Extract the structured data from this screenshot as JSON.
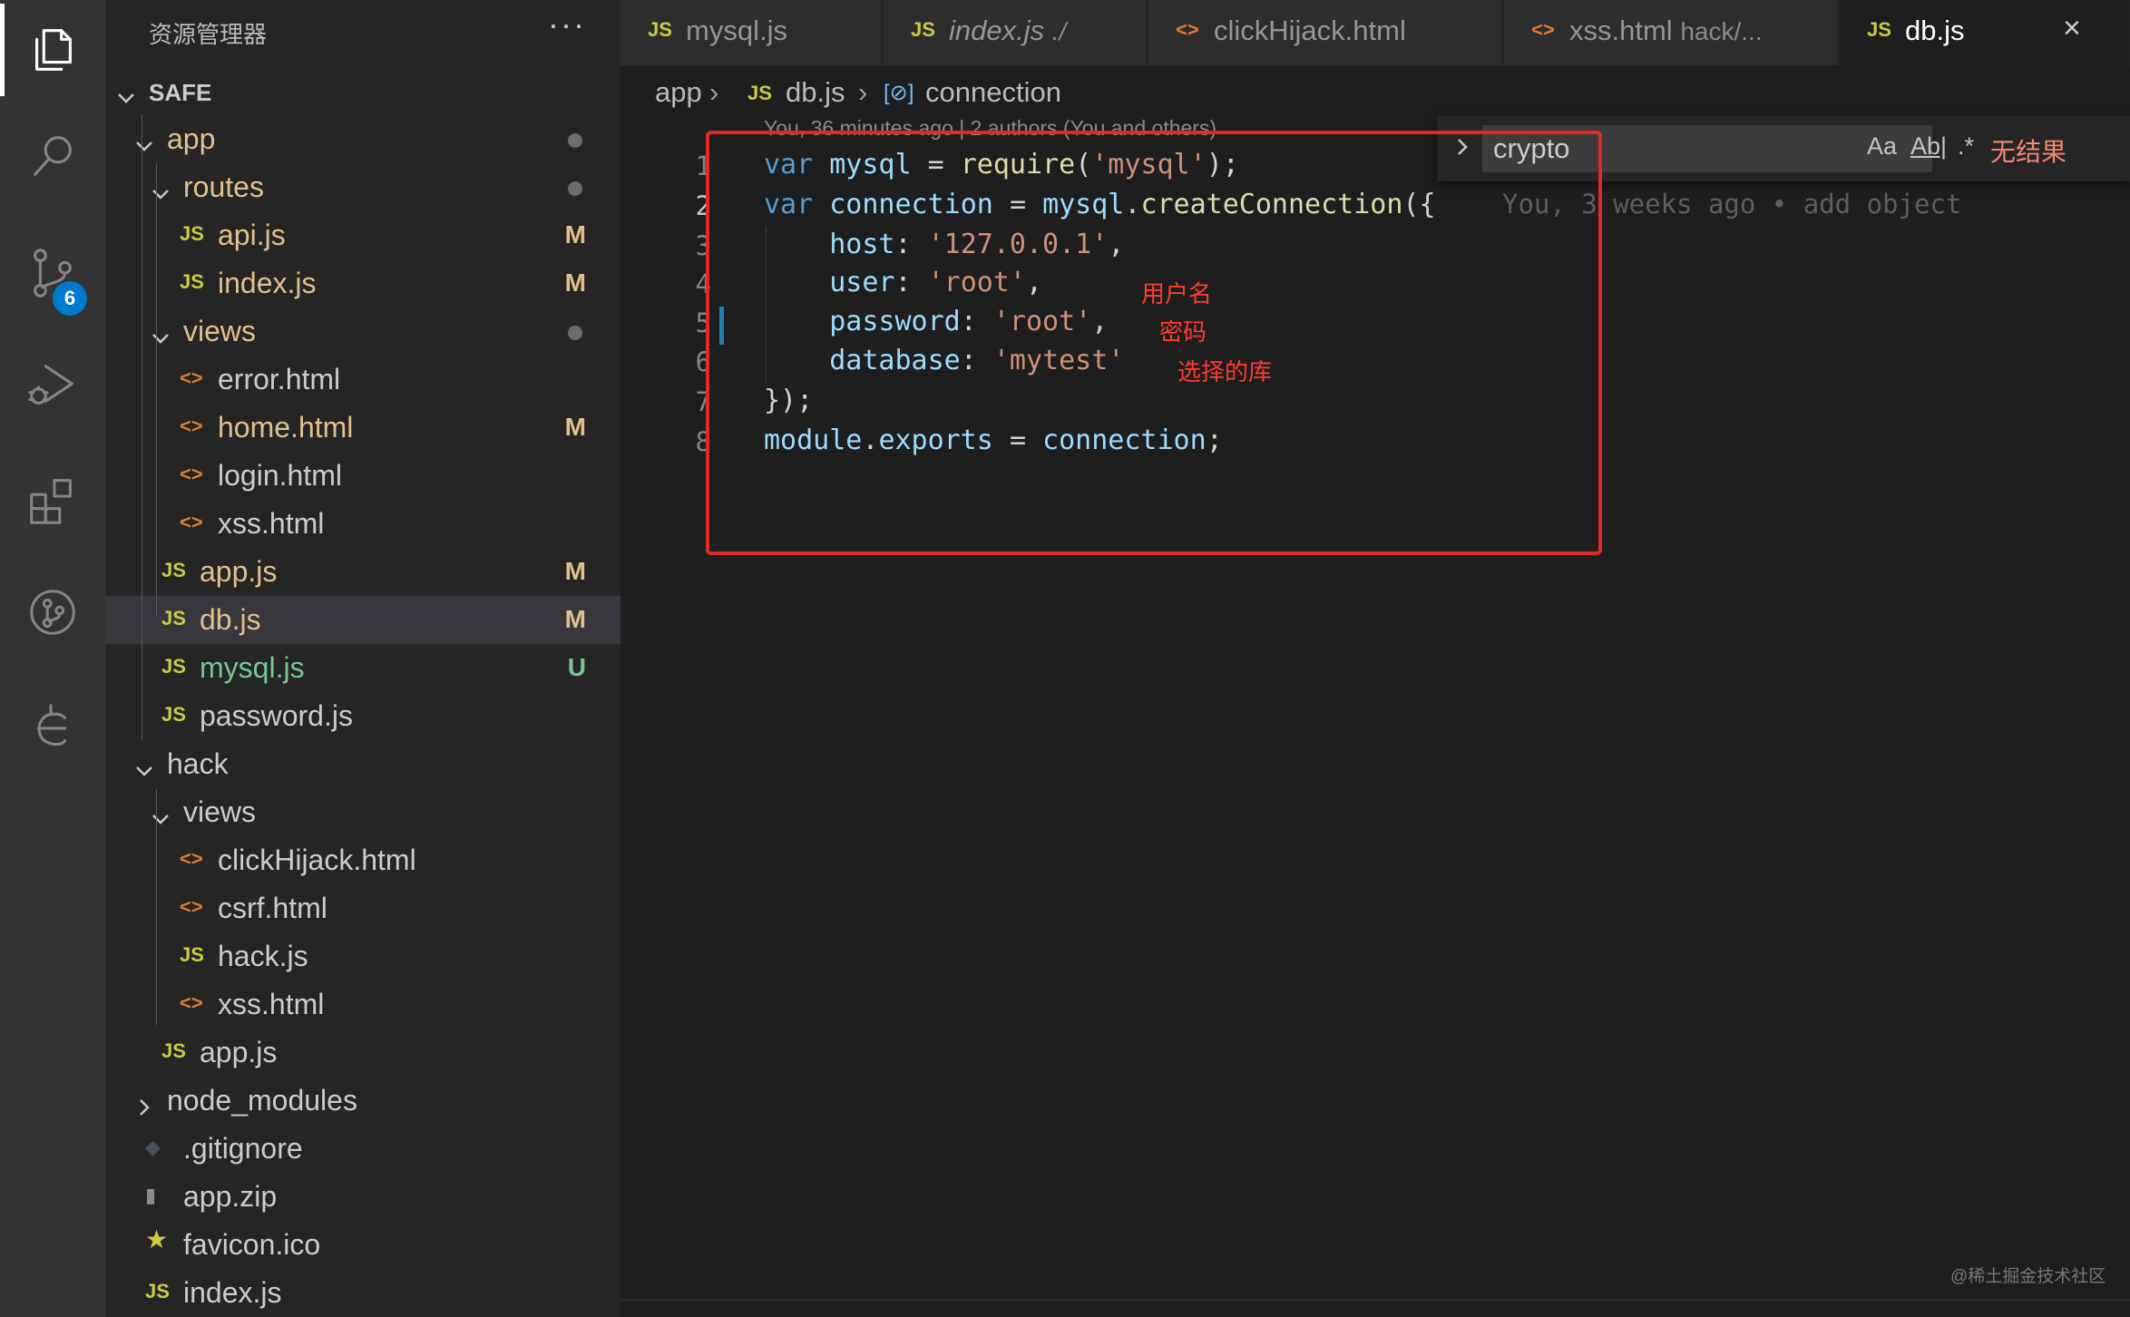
{
  "activity_bar": {
    "items": [
      {
        "name": "explorer",
        "icon": "files-icon",
        "active": true
      },
      {
        "name": "search",
        "icon": "search-icon",
        "active": false
      },
      {
        "name": "source-control",
        "icon": "source-control-icon",
        "active": false,
        "badge": "6"
      },
      {
        "name": "run-debug",
        "icon": "run-debug-icon",
        "active": false
      },
      {
        "name": "extensions",
        "icon": "extensions-icon",
        "active": false
      },
      {
        "name": "git-graph",
        "icon": "git-graph-icon",
        "active": false
      },
      {
        "name": "gitlens",
        "icon": "gitlens-icon",
        "active": false
      }
    ]
  },
  "sidebar": {
    "title": "资源管理器",
    "more": "···",
    "root": "SAFE",
    "items": [
      {
        "label": "app",
        "type": "folder",
        "open": true,
        "decoration": "dot",
        "color": "mod"
      },
      {
        "label": "routes",
        "type": "folder",
        "open": true,
        "decoration": "dot",
        "color": "mod"
      },
      {
        "label": "api.js",
        "type": "js",
        "decoration": "M",
        "color": "mod"
      },
      {
        "label": "index.js",
        "type": "js",
        "decoration": "M",
        "color": "mod"
      },
      {
        "label": "views",
        "type": "folder",
        "open": true,
        "decoration": "dot",
        "color": "mod"
      },
      {
        "label": "error.html",
        "type": "html",
        "decoration": "",
        "color": "plain"
      },
      {
        "label": "home.html",
        "type": "html",
        "decoration": "M",
        "color": "mod"
      },
      {
        "label": "login.html",
        "type": "html",
        "decoration": "",
        "color": "plain"
      },
      {
        "label": "xss.html",
        "type": "html",
        "decoration": "",
        "color": "plain"
      },
      {
        "label": "app.js",
        "type": "js",
        "decoration": "M",
        "color": "mod"
      },
      {
        "label": "db.js",
        "type": "js",
        "decoration": "M",
        "color": "mod",
        "selected": true
      },
      {
        "label": "mysql.js",
        "type": "js",
        "decoration": "U",
        "color": "unt"
      },
      {
        "label": "password.js",
        "type": "js",
        "decoration": "",
        "color": "plain"
      },
      {
        "label": "hack",
        "type": "folder",
        "open": true,
        "decoration": "",
        "color": "plain"
      },
      {
        "label": "views",
        "type": "folder",
        "open": true,
        "decoration": "",
        "color": "plain"
      },
      {
        "label": "clickHijack.html",
        "type": "html",
        "decoration": "",
        "color": "plain"
      },
      {
        "label": "csrf.html",
        "type": "html",
        "decoration": "",
        "color": "plain"
      },
      {
        "label": "hack.js",
        "type": "js",
        "decoration": "",
        "color": "plain"
      },
      {
        "label": "xss.html",
        "type": "html",
        "decoration": "",
        "color": "plain"
      },
      {
        "label": "app.js",
        "type": "js",
        "decoration": "",
        "color": "plain"
      },
      {
        "label": "node_modules",
        "type": "folder",
        "open": false,
        "decoration": "",
        "color": "plain"
      },
      {
        "label": ".gitignore",
        "type": "git",
        "decoration": "",
        "color": "plain"
      },
      {
        "label": "app.zip",
        "type": "zip",
        "decoration": "",
        "color": "plain"
      },
      {
        "label": "favicon.ico",
        "type": "star",
        "decoration": "",
        "color": "plain"
      },
      {
        "label": "index.js",
        "type": "js",
        "decoration": "",
        "color": "plain"
      }
    ]
  },
  "tabs": [
    {
      "label": "mysql.js",
      "icon": "JS",
      "desc": "",
      "italic": false,
      "active": false
    },
    {
      "label": "index.js",
      "icon": "JS",
      "desc": "./",
      "italic": true,
      "active": false
    },
    {
      "label": "clickHijack.html",
      "icon": "<>",
      "desc": "",
      "italic": false,
      "active": false
    },
    {
      "label": "xss.html",
      "icon": "<>",
      "desc": "hack/...",
      "italic": false,
      "active": false
    },
    {
      "label": "db.js",
      "icon": "JS",
      "desc": "",
      "italic": false,
      "active": true,
      "close": "×"
    }
  ],
  "breadcrumb": {
    "folder": "app",
    "file_icon": "JS",
    "file": "db.js",
    "symbol_icon": "[⊘]",
    "symbol": "connection",
    "separator": "›"
  },
  "editor": {
    "blame_header": "You, 36 minutes ago | 2 authors (You and others)",
    "line_numbers": [
      "1",
      "2",
      "3",
      "4",
      "5",
      "6",
      "7",
      "8"
    ],
    "ghost_blame": "You, 3 weeks ago • add object"
  },
  "find_widget": {
    "query": "crypto",
    "match_case": "Aa",
    "whole_word": "Ab|",
    "regex": ".*",
    "result": "无结果"
  },
  "annotations": {
    "username": "用户名",
    "password": "密码",
    "database": "选择的库"
  },
  "watermark": "@稀土掘金技术社区",
  "colors": {
    "mod": "#e2c08d",
    "unt": "#73c991",
    "plain": "#cccccc",
    "badge": "#007acc",
    "annotation": "#ff3b2f",
    "highlight_box": "#e02b24"
  }
}
